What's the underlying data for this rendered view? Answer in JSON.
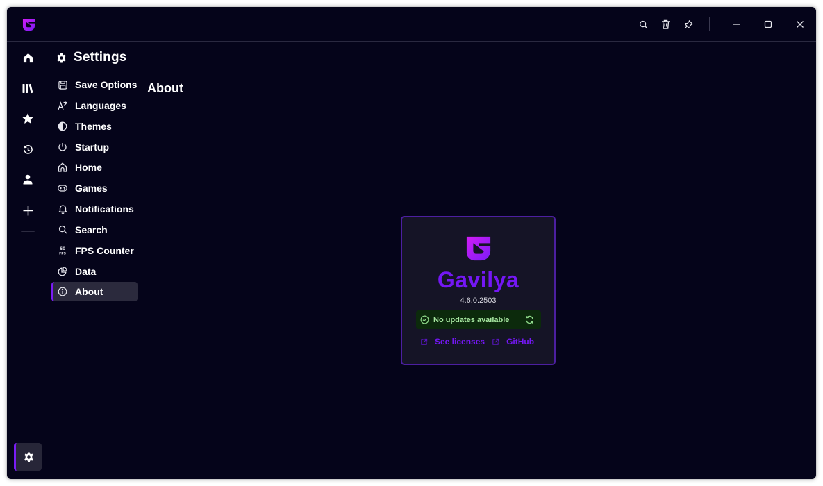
{
  "app": {
    "name": "Gavilya",
    "accent_color": "#7a1cf5",
    "logo_gradient": [
      "#d21cf5",
      "#7a1cf5"
    ]
  },
  "titlebar": {
    "buttons": [
      {
        "name": "search",
        "icon": "search-icon"
      },
      {
        "name": "trash",
        "icon": "trash-icon"
      },
      {
        "name": "pin",
        "icon": "pin-icon"
      },
      {
        "name": "minimize",
        "icon": "minimize-icon"
      },
      {
        "name": "maximize",
        "icon": "maximize-icon"
      },
      {
        "name": "close",
        "icon": "close-icon"
      }
    ]
  },
  "rail": {
    "items": [
      {
        "name": "home",
        "icon": "home-icon"
      },
      {
        "name": "library",
        "icon": "library-icon"
      },
      {
        "name": "favorites",
        "icon": "star-icon"
      },
      {
        "name": "recent",
        "icon": "history-icon"
      },
      {
        "name": "profile",
        "icon": "user-icon"
      },
      {
        "name": "add",
        "icon": "plus-icon"
      }
    ],
    "bottom": {
      "name": "settings",
      "icon": "gear-icon",
      "active": true
    }
  },
  "settings": {
    "title": "Settings",
    "nav": [
      {
        "label": "Save Options",
        "icon": "save-icon"
      },
      {
        "label": "Languages",
        "icon": "translate-icon"
      },
      {
        "label": "Themes",
        "icon": "contrast-icon"
      },
      {
        "label": "Startup",
        "icon": "power-icon"
      },
      {
        "label": "Home",
        "icon": "home-outline-icon"
      },
      {
        "label": "Games",
        "icon": "gamepad-icon"
      },
      {
        "label": "Notifications",
        "icon": "bell-icon"
      },
      {
        "label": "Search",
        "icon": "search-icon"
      },
      {
        "label": "FPS Counter",
        "icon": "fps-icon"
      },
      {
        "label": "Data",
        "icon": "pie-chart-icon"
      },
      {
        "label": "About",
        "icon": "info-icon",
        "active": true
      }
    ]
  },
  "page": {
    "heading": "About",
    "card": {
      "app_name": "Gavilya",
      "version": "4.6.0.2503",
      "update_status": "No updates available",
      "status_color": "#a6e6a0",
      "links": [
        {
          "label": "See licenses",
          "icon": "external-link-icon"
        },
        {
          "label": "GitHub",
          "icon": "external-link-icon"
        }
      ]
    }
  }
}
